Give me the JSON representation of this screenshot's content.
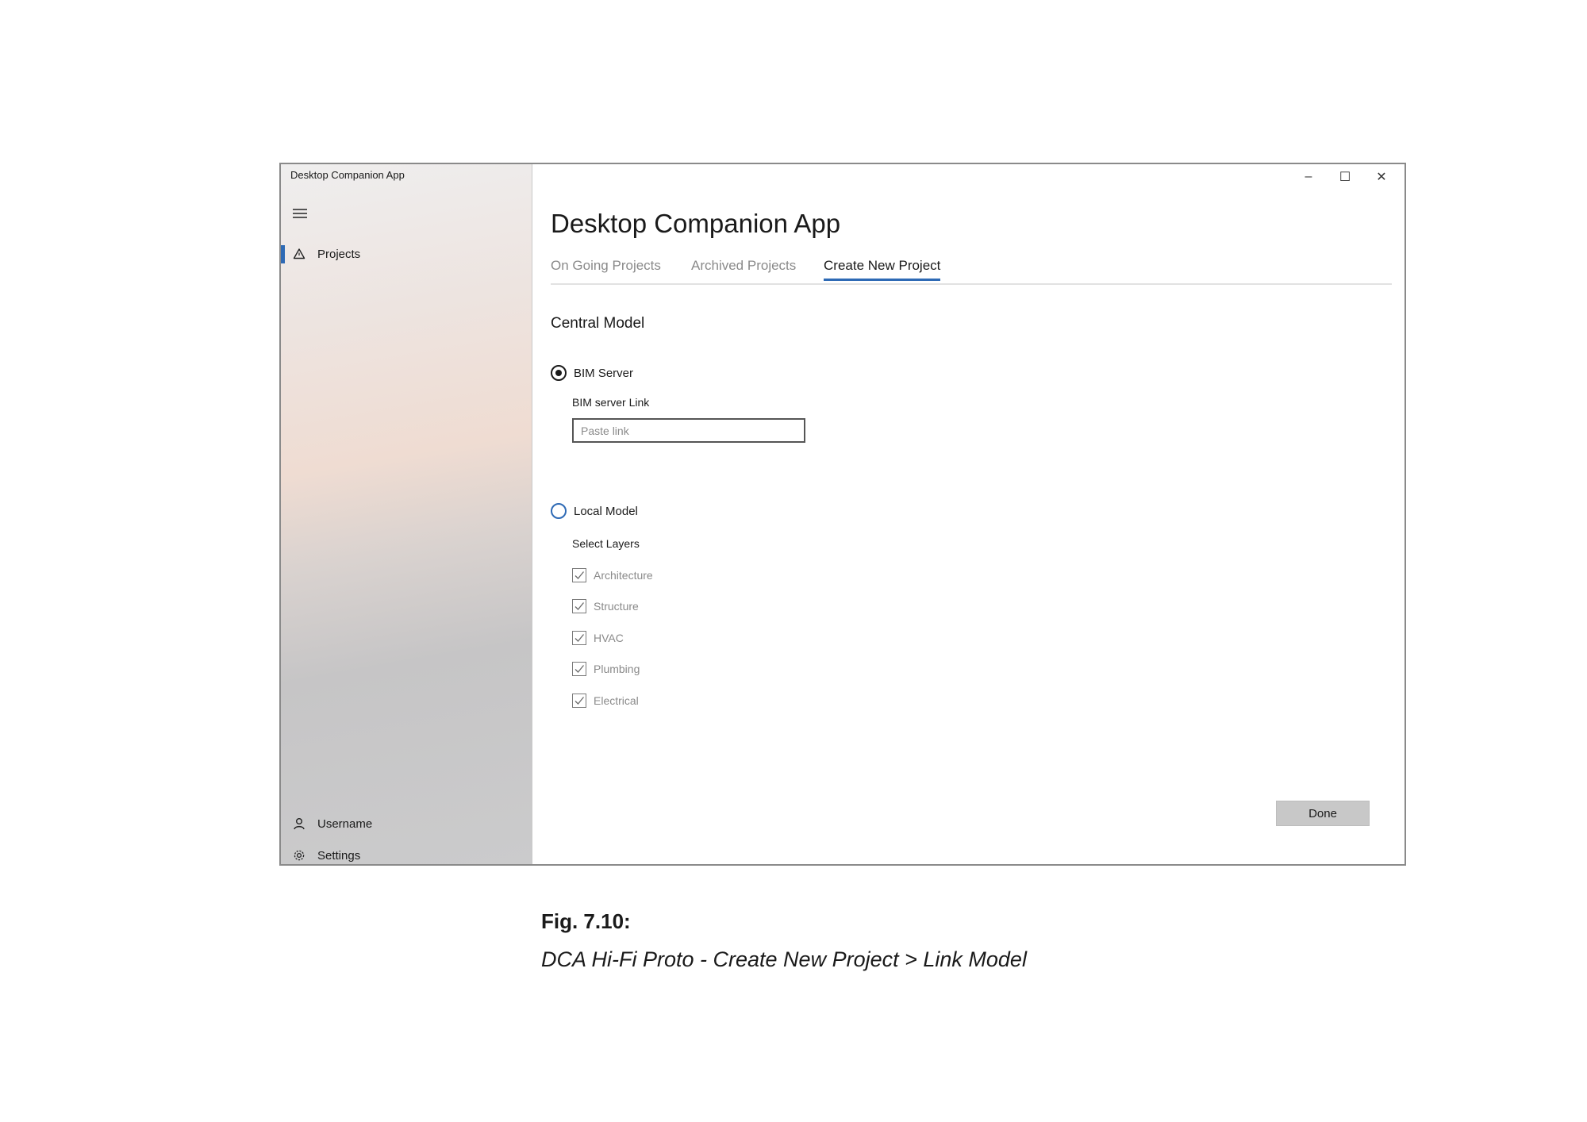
{
  "window": {
    "title": "Desktop Companion App",
    "controls": {
      "minimize": "–",
      "maximize": "☐",
      "close": "✕"
    }
  },
  "sidebar": {
    "menu_icon": "hamburger-icon",
    "items": [
      {
        "label": "Projects",
        "icon": "projects-icon",
        "active": true
      }
    ],
    "footer": [
      {
        "label": "Username",
        "icon": "user-icon"
      },
      {
        "label": "Settings",
        "icon": "gear-icon"
      }
    ]
  },
  "main": {
    "title": "Desktop Companion App",
    "tabs": [
      {
        "label": "On Going Projects",
        "active": false
      },
      {
        "label": "Archived Projects",
        "active": false
      },
      {
        "label": "Create New Project",
        "active": true
      }
    ],
    "section_title": "Central Model",
    "bim_server": {
      "radio_label": "BIM Server",
      "selected": true,
      "link_label": "BIM server Link",
      "link_value": "",
      "link_placeholder": "Paste link"
    },
    "local_model": {
      "radio_label": "Local Model",
      "selected": false,
      "layers_label": "Select Layers",
      "layers": [
        {
          "label": "Architecture",
          "checked": true
        },
        {
          "label": "Structure",
          "checked": true
        },
        {
          "label": "HVAC",
          "checked": true
        },
        {
          "label": "Plumbing",
          "checked": true
        },
        {
          "label": "Electrical",
          "checked": true
        }
      ]
    },
    "done_label": "Done"
  },
  "caption": {
    "figure": "Fig. 7.10:",
    "text": "DCA Hi-Fi Proto - Create New Project > Link Model"
  },
  "colors": {
    "accent": "#2e6ab5",
    "button_bg": "#c8c8c8"
  }
}
